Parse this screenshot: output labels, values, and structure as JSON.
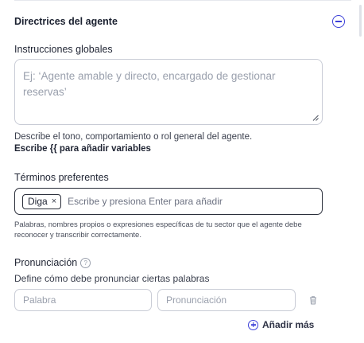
{
  "section": {
    "title": "Directrices del agente"
  },
  "global_instructions": {
    "label": "Instrucciones globales",
    "placeholder": "Ej: ‘Agente amable y directo, encargado de gestionar reservas’",
    "helper": "Describe el tono, comportamiento o rol general del agente.",
    "variables_hint": "Escribe {{ para añadir variables"
  },
  "preferred_terms": {
    "label": "Términos preferentes",
    "chips": [
      "Diga"
    ],
    "chip_remove": "×",
    "placeholder": "Escribe y presiona Enter para añadir",
    "helper": "Palabras, nombres propios o expresiones específicas de tu sector que el agente debe reconocer y transcribir correctamente."
  },
  "pronunciation": {
    "label": "Pronunciación",
    "help_glyph": "?",
    "description": "Define cómo debe pronunciar ciertas palabras",
    "word_placeholder": "Palabra",
    "pronunciation_placeholder": "Pronunciación",
    "add_more_label": "Añadir más"
  },
  "colors": {
    "accent": "#3b3fd8",
    "border": "#c9ccd6",
    "text": "#1f2433",
    "muted": "#9aa0ad"
  }
}
